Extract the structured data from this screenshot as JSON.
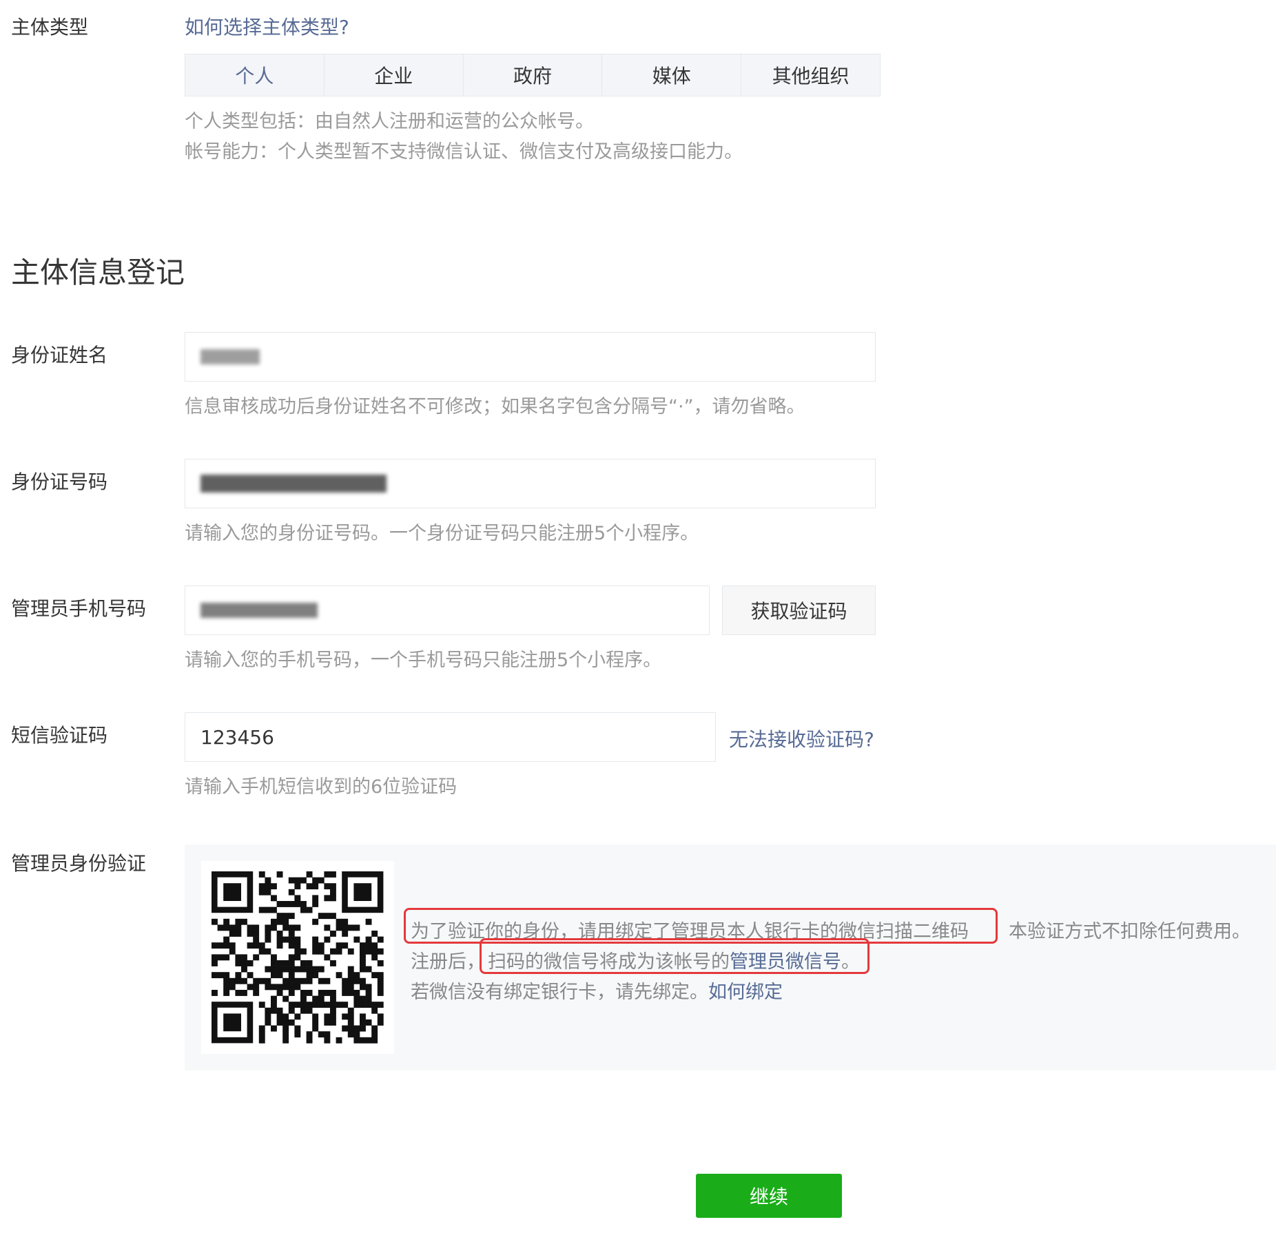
{
  "entity_type": {
    "label": "主体类型",
    "help_link": "如何选择主体类型?",
    "tabs": [
      "个人",
      "企业",
      "政府",
      "媒体",
      "其他组织"
    ],
    "active_tab": "个人",
    "desc_line1": "个人类型包括：由自然人注册和运营的公众帐号。",
    "desc_line2": "帐号能力：个人类型暂不支持微信认证、微信支付及高级接口能力。"
  },
  "section_title": "主体信息登记",
  "id_name": {
    "label": "身份证姓名",
    "tip": "信息审核成功后身份证姓名不可修改；如果名字包含分隔号“·”，请勿省略。"
  },
  "id_number": {
    "label": "身份证号码",
    "tip": "请输入您的身份证号码。一个身份证号码只能注册5个小程序。"
  },
  "admin_phone": {
    "label": "管理员手机号码",
    "button": "获取验证码",
    "tip": "请输入您的手机号码，一个手机号码只能注册5个小程序。"
  },
  "sms_code": {
    "label": "短信验证码",
    "value": "123456",
    "help_link": "无法接收验证码?",
    "tip": "请输入手机短信收到的6位验证码"
  },
  "admin_verify": {
    "label": "管理员身份验证",
    "line1_highlight": "为了验证你的身份，请用绑定了管理员本人银行卡的微信扫描二维码",
    "line1_rest": "本验证方式不扣除任何费用。",
    "line2_prefix": "注册后，",
    "line2_highlight_plain": "扫码的微信号将成为该帐号的",
    "line2_highlight_link": "管理员微信号",
    "line2_suffix": "。",
    "line3_text": "若微信没有绑定银行卡，请先绑定。",
    "line3_link": "如何绑定",
    "highlight_color": "#e4393c"
  },
  "continue_button": "继续",
  "colors": {
    "link": "#576b95",
    "primary_button": "#1aad19",
    "tip_text": "#9a9a9a"
  }
}
